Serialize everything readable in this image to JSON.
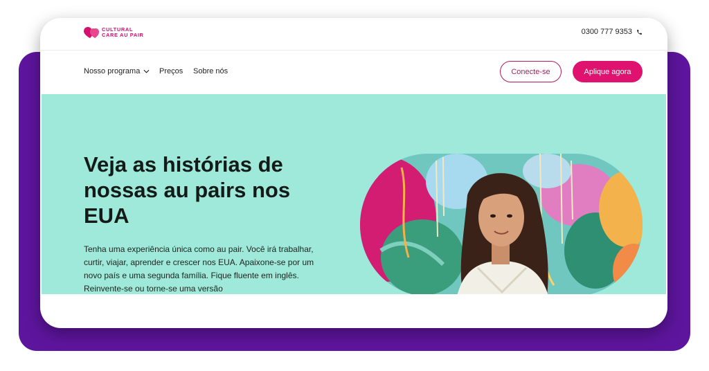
{
  "brand": {
    "logo_line1": "CULTURAL",
    "logo_line2": "CARE AU PAIR",
    "color": "#d6106e"
  },
  "header": {
    "phone_number": "0300 777 9353",
    "phone_icon": "phone-icon"
  },
  "nav": {
    "items": [
      {
        "label": "Nosso programa",
        "has_dropdown": true
      },
      {
        "label": "Preços"
      },
      {
        "label": "Sobre nós"
      }
    ],
    "login_label": "Conecte-se",
    "apply_label": "Aplique agora"
  },
  "hero": {
    "title": "Veja as histórias de nossas au pairs nos EUA",
    "body": "Tenha uma experiência única como au pair. Você irá trabalhar, curtir, viajar, aprender e crescer nos EUA. Apaixone-se por um novo país e uma segunda família. Fique fluente em inglês. Reinvente-se ou torne-se uma versão",
    "background_color": "#9ee9d9",
    "image": "young-woman-in-front-of-graffiti-mural"
  },
  "colors": {
    "frame_purple": "#5e159e",
    "accent_pink": "#e0126f",
    "outline_button": "#b0195e"
  }
}
